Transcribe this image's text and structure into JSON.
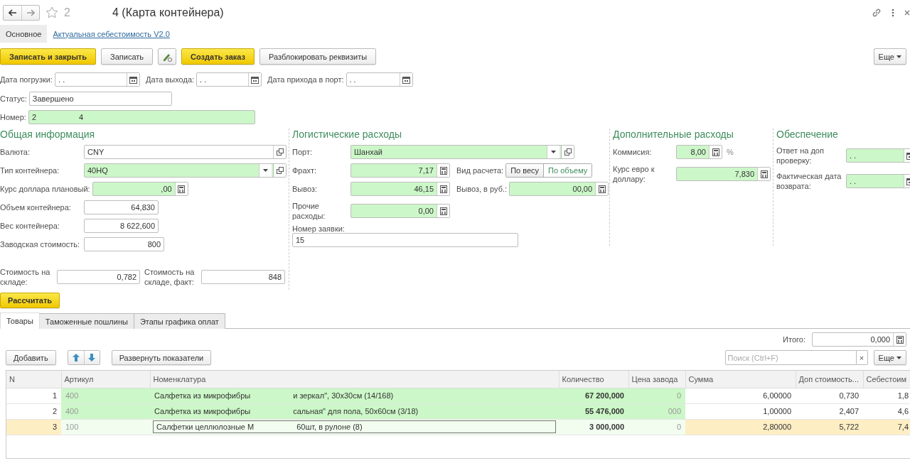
{
  "header": {
    "title_parts": [
      "2",
      "4 (Карта контейнера)"
    ]
  },
  "nav_tabs": [
    {
      "label": "Основное",
      "selected": true
    },
    {
      "label": "Актуальная себестоимость V2.0",
      "selected": false
    }
  ],
  "toolbar": [
    {
      "kind": "primary",
      "label": "Записать и закрыть"
    },
    {
      "kind": "normal",
      "label": "Записать"
    },
    {
      "kind": "icon"
    },
    {
      "kind": "primary",
      "label": "Создать заказ"
    },
    {
      "kind": "normal",
      "label": "Разблокировать реквизиты"
    },
    {
      "kind": "menu",
      "label": "Еще"
    }
  ],
  "dates": [
    {
      "label": "Дата погрузки:",
      "value": ". .",
      "kind": "date",
      "highlighted": false
    },
    {
      "label": "Дата выхода:",
      "value": ". .",
      "kind": "date",
      "highlighted": false
    },
    {
      "label": "Дата прихода в порт:",
      "value": ". .",
      "kind": "date",
      "highlighted": false
    }
  ],
  "status": {
    "label": "Статус:",
    "value": "Завершено",
    "highlighted": false
  },
  "number": {
    "label": "Номер:",
    "value": [
      "2",
      "4"
    ],
    "highlighted": true
  },
  "sections": [
    {
      "title": "Общая информация",
      "fields": [
        {
          "label": "Валюта:",
          "value": "CNY",
          "kind": "ref",
          "highlighted": false
        },
        {
          "label": "Тип контейнера:",
          "value": "40HQ",
          "kind": "select",
          "highlighted": true
        },
        {
          "label": "Курс доллара плановый:",
          "value": ",00",
          "kind": "number",
          "highlighted": true
        },
        {
          "label": "Объем контейнера:",
          "value": "64,830",
          "kind": "plain-number",
          "highlighted": false
        },
        {
          "label": "Вес контейнера:",
          "value": "8 622,600",
          "kind": "plain-number",
          "highlighted": false
        },
        {
          "label": "Заводская стоимость:",
          "value": "800",
          "kind": "plain-number",
          "highlighted": false
        }
      ]
    },
    {
      "title": "Логистические расходы",
      "fields": [
        {
          "label": "Порт:",
          "value": "Шанхай",
          "kind": "select",
          "highlighted": true
        },
        {
          "label": "Фрахт:",
          "value": "7,17",
          "kind": "number",
          "highlighted": true,
          "extra": {
            "kind": "toggle",
            "label": "Вид расчета:",
            "options": [
              {
                "label": "По весу",
                "selected": false
              },
              {
                "label": "По объему",
                "selected": true
              }
            ]
          }
        },
        {
          "label": "Вывоз:",
          "value": "46,15",
          "kind": "number",
          "highlighted": true,
          "extra": {
            "kind": "number",
            "label": "Вывоз, в руб.:",
            "value": "00,00",
            "highlighted": true
          }
        },
        {
          "label": "Прочие расходы:",
          "value": "0,00",
          "kind": "number",
          "highlighted": true
        }
      ],
      "request": {
        "label": "Номер заявки:",
        "value": "15",
        "highlighted": false
      }
    },
    {
      "title": "Дополнительные расходы",
      "fields": [
        {
          "label": "Коммисия:",
          "value": "8,00",
          "kind": "number",
          "highlighted": true,
          "unit": "%"
        },
        {
          "label": "Курс евро к доллару:",
          "value": "7,830",
          "kind": "number",
          "highlighted": true
        }
      ]
    },
    {
      "title": "Обеспечение",
      "fields": [
        {
          "label": "Ответ на доп проверку:",
          "value": ". .",
          "kind": "date",
          "highlighted": true
        },
        {
          "label": "Фактическая дата возврата:",
          "value": ". .",
          "kind": "date",
          "highlighted": true
        }
      ]
    }
  ],
  "warehouse": [
    {
      "label": "Стоимость на складе:",
      "value": "0,782",
      "kind": "plain-number",
      "highlighted": false
    },
    {
      "label": "Стоимость на складе, факт:",
      "value": "848",
      "kind": "plain-number",
      "highlighted": false
    }
  ],
  "calculate_button": "Рассчитать",
  "tabs": [
    {
      "label": "Товары",
      "selected": true
    },
    {
      "label": "Таможенные пошлины",
      "selected": false
    },
    {
      "label": "Этапы графика оплат",
      "selected": false
    }
  ],
  "total": {
    "label": "Итого:",
    "value": "0,000",
    "kind": "number",
    "highlighted": false
  },
  "table_toolbar": {
    "add": "Добавить",
    "expand": "Развернуть показатели",
    "search_placeholder": "Поиск (Ctrl+F)",
    "clear": "×",
    "more": "Еще"
  },
  "table": {
    "columns": [
      "N",
      "Артикул",
      "Номенклатура",
      "Количество",
      "Цена завода",
      "Сумма",
      "Доп стоимость...",
      "Себестоим"
    ],
    "rows": [
      {
        "n": "1",
        "article": "400",
        "name": [
          "Салфетка из микрофибры",
          "и зеркал\", 30х30см (14/168)"
        ],
        "quantity": "67 200,000",
        "price": "0",
        "sum": "6,00000",
        "extra": "0,730",
        "cost": "1,8",
        "highlighted": true,
        "selected": false
      },
      {
        "n": "2",
        "article": "400",
        "name": [
          "Салфетка из микрофибры",
          "сальная\" для пола, 50х60см (3/18)"
        ],
        "quantity": "55 476,000",
        "price": "000",
        "sum": "1,00000",
        "extra": "2,407",
        "cost": "4,6",
        "highlighted": true,
        "selected": false
      },
      {
        "n": "3",
        "article": "100",
        "name": [
          "Салфетки целлюлозные М",
          "60шт, в рулоне (8)"
        ],
        "quantity": "3 000,000",
        "price": "0",
        "sum": "2,80000",
        "extra": "5,722",
        "cost": "7,4",
        "highlighted": false,
        "selected": true
      }
    ]
  }
}
